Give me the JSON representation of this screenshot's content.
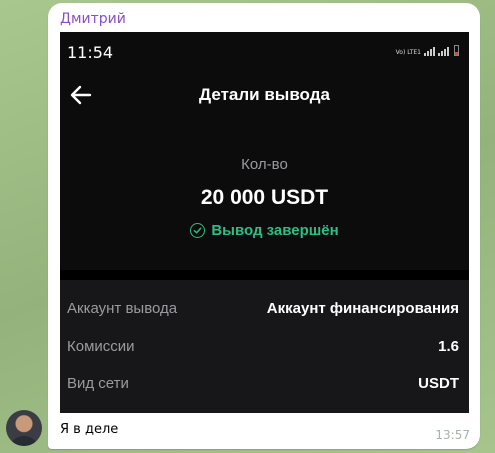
{
  "message": {
    "sender": "Дмитрий",
    "caption": "Я в деле",
    "time": "13:57"
  },
  "screenshot": {
    "status_bar": {
      "time": "11:54",
      "network": "Vo) LTE1"
    },
    "header": {
      "title": "Детали вывода",
      "back_icon": "arrow-left-icon"
    },
    "amount": {
      "label": "Кол-во",
      "value": "20 000 USDT"
    },
    "status": {
      "text": "Вывод завершён",
      "icon": "check-circle-icon",
      "color": "#2ebd85"
    },
    "details": [
      {
        "label": "Аккаунт вывода",
        "value": "Аккаунт финансирования"
      },
      {
        "label": "Комиссии",
        "value": "1.6"
      },
      {
        "label": "Вид сети",
        "value": "USDT"
      }
    ]
  },
  "colors": {
    "accent_sender": "#8a4fc8",
    "success": "#2ebd85",
    "screen_bg": "#0c0c0d",
    "card_bg": "#17171a"
  }
}
